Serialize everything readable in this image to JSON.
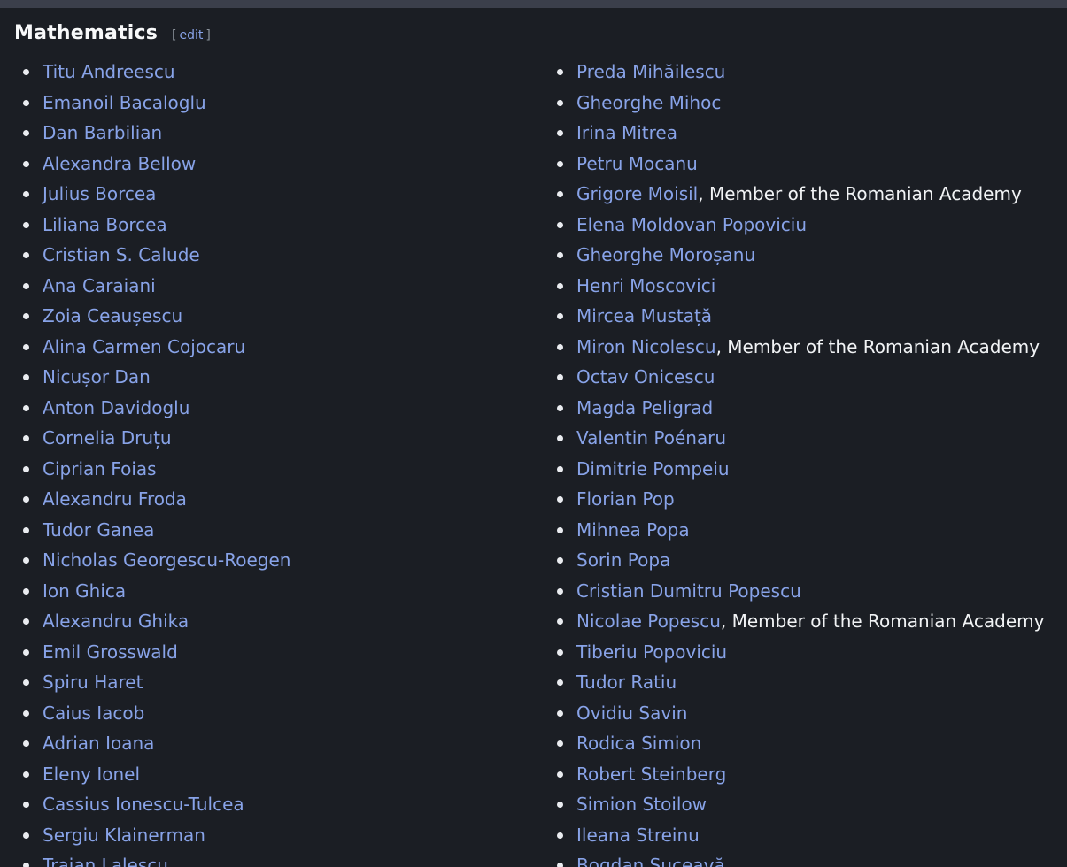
{
  "section": {
    "title": "Mathematics",
    "edit_open": "[",
    "edit_label": "edit",
    "edit_close": "]"
  },
  "left_column": [
    {
      "name": "Titu Andreescu",
      "note": ""
    },
    {
      "name": "Emanoil Bacaloglu",
      "note": ""
    },
    {
      "name": "Dan Barbilian",
      "note": ""
    },
    {
      "name": "Alexandra Bellow",
      "note": ""
    },
    {
      "name": "Julius Borcea",
      "note": ""
    },
    {
      "name": "Liliana Borcea",
      "note": ""
    },
    {
      "name": "Cristian S. Calude",
      "note": ""
    },
    {
      "name": "Ana Caraiani",
      "note": ""
    },
    {
      "name": "Zoia Ceaușescu",
      "note": ""
    },
    {
      "name": "Alina Carmen Cojocaru",
      "note": ""
    },
    {
      "name": "Nicușor Dan",
      "note": ""
    },
    {
      "name": "Anton Davidoglu",
      "note": ""
    },
    {
      "name": "Cornelia Druțu",
      "note": ""
    },
    {
      "name": "Ciprian Foias",
      "note": ""
    },
    {
      "name": "Alexandru Froda",
      "note": ""
    },
    {
      "name": "Tudor Ganea",
      "note": ""
    },
    {
      "name": "Nicholas Georgescu-Roegen",
      "note": ""
    },
    {
      "name": "Ion Ghica",
      "note": ""
    },
    {
      "name": "Alexandru Ghika",
      "note": ""
    },
    {
      "name": "Emil Grosswald",
      "note": ""
    },
    {
      "name": "Spiru Haret",
      "note": ""
    },
    {
      "name": "Caius Iacob",
      "note": ""
    },
    {
      "name": "Adrian Ioana",
      "note": ""
    },
    {
      "name": "Eleny Ionel",
      "note": ""
    },
    {
      "name": "Cassius Ionescu-Tulcea",
      "note": ""
    },
    {
      "name": "Sergiu Klainerman",
      "note": ""
    },
    {
      "name": "Traian Lalescu",
      "note": ""
    }
  ],
  "right_column": [
    {
      "name": "Preda Mihăilescu",
      "note": ""
    },
    {
      "name": "Gheorghe Mihoc",
      "note": ""
    },
    {
      "name": "Irina Mitrea",
      "note": ""
    },
    {
      "name": "Petru Mocanu",
      "note": ""
    },
    {
      "name": "Grigore Moisil",
      "note": ", Member of the Romanian Academy"
    },
    {
      "name": "Elena Moldovan Popoviciu",
      "note": ""
    },
    {
      "name": "Gheorghe Moroșanu",
      "note": ""
    },
    {
      "name": "Henri Moscovici",
      "note": ""
    },
    {
      "name": "Mircea Mustață",
      "note": ""
    },
    {
      "name": "Miron Nicolescu",
      "note": ", Member of the Romanian Academy"
    },
    {
      "name": "Octav Onicescu",
      "note": ""
    },
    {
      "name": "Magda Peligrad",
      "note": ""
    },
    {
      "name": "Valentin Poénaru",
      "note": ""
    },
    {
      "name": "Dimitrie Pompeiu",
      "note": ""
    },
    {
      "name": "Florian Pop",
      "note": ""
    },
    {
      "name": "Mihnea Popa",
      "note": ""
    },
    {
      "name": "Sorin Popa",
      "note": ""
    },
    {
      "name": "Cristian Dumitru Popescu",
      "note": ""
    },
    {
      "name": "Nicolae Popescu",
      "note": ", Member of the Romanian Academy"
    },
    {
      "name": "Tiberiu Popoviciu",
      "note": ""
    },
    {
      "name": "Tudor Ratiu",
      "note": ""
    },
    {
      "name": "Ovidiu Savin",
      "note": ""
    },
    {
      "name": "Rodica Simion",
      "note": ""
    },
    {
      "name": "Robert Steinberg",
      "note": ""
    },
    {
      "name": "Simion Stoilow",
      "note": ""
    },
    {
      "name": "Ileana Streinu",
      "note": ""
    },
    {
      "name": "Bogdan Suceavă",
      "note": ""
    }
  ],
  "colors": {
    "background": "#1b1e24",
    "link": "#88a3e8",
    "text": "#f1f3f5",
    "top_bar": "#3b3f4b"
  }
}
